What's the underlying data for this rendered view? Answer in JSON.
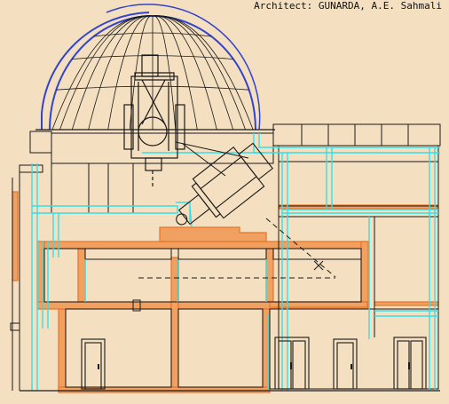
{
  "caption": "Architect: GUNARDA, A.E. Sahmali",
  "colors": {
    "background": "#f4dfc0",
    "ink": "#1a1a1a",
    "dome_outline": "#3344cc",
    "structure_cyan": "#33e0e8",
    "masonry_orange": "#e8742a",
    "masonry_fill": "#f0a060"
  },
  "drawing": {
    "subject": "observatory-section",
    "elements": [
      "dome",
      "telescope",
      "spectrograph",
      "pier",
      "floors",
      "doors"
    ]
  }
}
